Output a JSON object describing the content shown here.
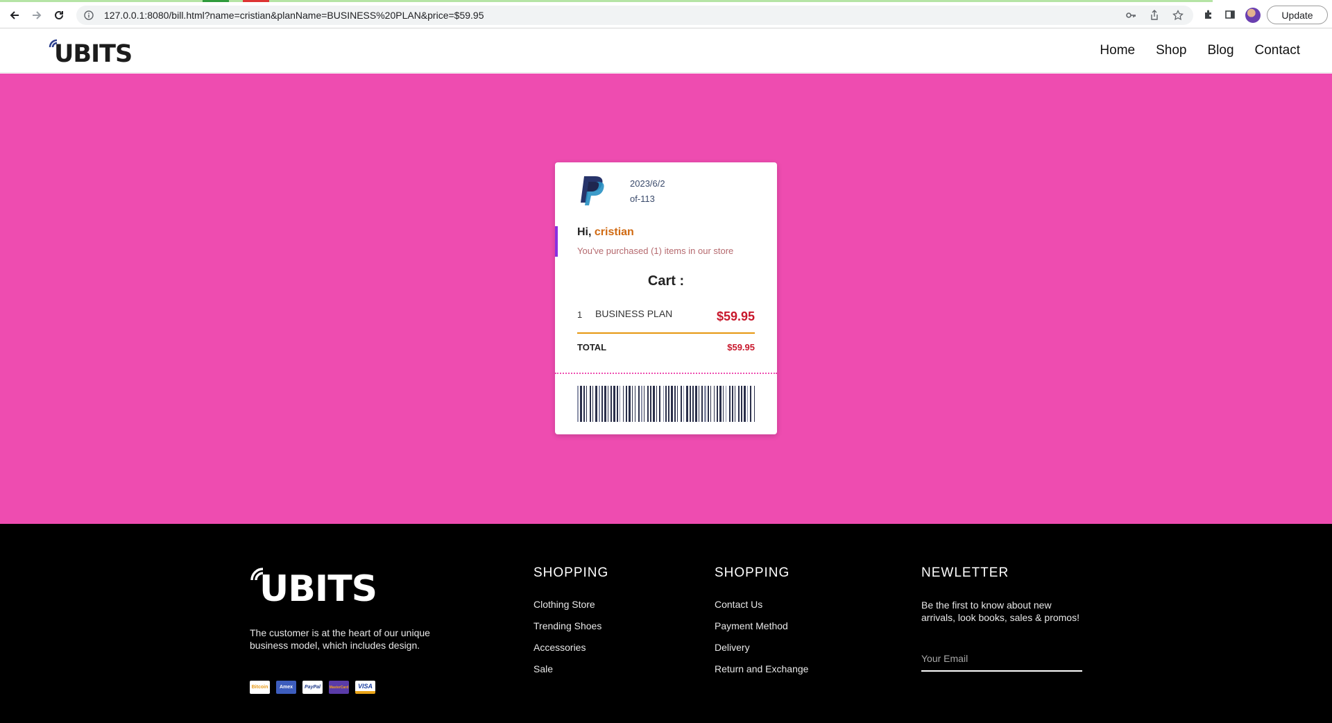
{
  "browser": {
    "url": "127.0.0.1:8080/bill.html?name=cristian&planName=BUSINESS%20PLAN&price=$59.95",
    "update_label": "Update"
  },
  "header": {
    "logo": "UBITS",
    "nav": [
      "Home",
      "Shop",
      "Blog",
      "Contact"
    ]
  },
  "receipt": {
    "date": "2023/6/2",
    "order_id": "of-113",
    "greeting": "Hi,",
    "customer_name": "cristian",
    "purchased_text": "You've purchased (1) items in our store",
    "cart_title": "Cart :",
    "items": [
      {
        "qty": "1",
        "name": "BUSINESS PLAN",
        "price": "$59.95"
      }
    ],
    "total_label": "TOTAL",
    "total_value": "$59.95"
  },
  "footer": {
    "logo": "UBITS",
    "description": "The customer is at the heart of our unique business model, which includes design.",
    "payment_cards": [
      "Bitcoin",
      "Amex",
      "PayPal",
      "MasterCard",
      "VISA"
    ],
    "columns": [
      {
        "title": "SHOPPING",
        "links": [
          "Clothing Store",
          "Trending Shoes",
          "Accessories",
          "Sale"
        ]
      },
      {
        "title": "SHOPPING",
        "links": [
          "Contact Us",
          "Payment Method",
          "Delivery",
          "Return and Exchange"
        ]
      }
    ],
    "newsletter": {
      "title": "NEWLETTER",
      "text": "Be the first to know about new arrivals, look books, sales & promos!",
      "placeholder": "Your Email"
    }
  },
  "colors": {
    "hero_bg": "#ee4cb0",
    "price_red": "#c8182c",
    "name_orange": "#d06a12",
    "divider_orange": "#e6960f",
    "accent_purple": "#8b2fe0"
  }
}
